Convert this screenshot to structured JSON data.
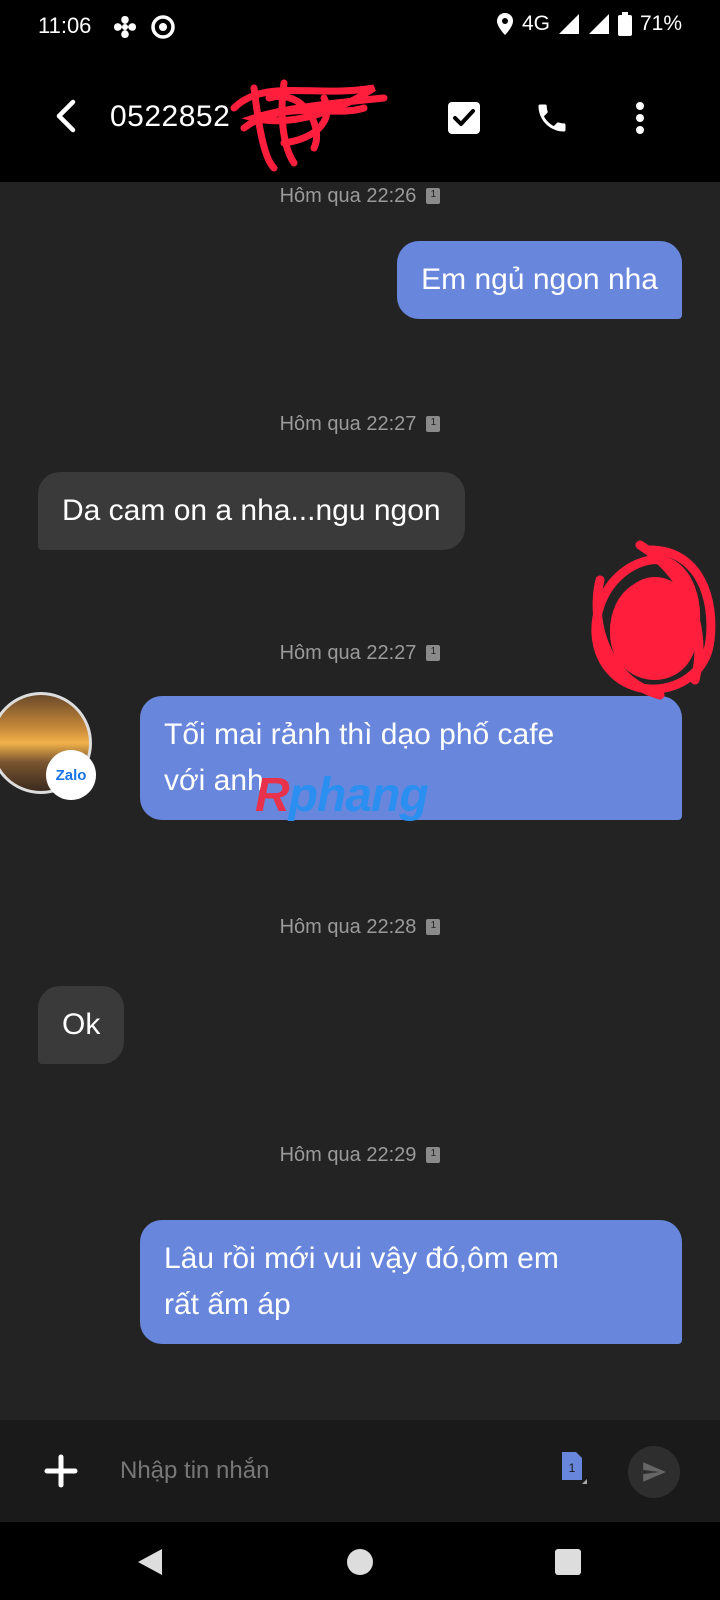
{
  "status_bar": {
    "time": "11:06",
    "network": "4G",
    "battery": "71%"
  },
  "header": {
    "contact": "0522852",
    "accent_color": "#6886dc"
  },
  "messages": [
    {
      "timestamp": "Hôm qua 22:26",
      "direction": "out",
      "text": "Em ngủ ngon nha"
    },
    {
      "timestamp": "Hôm qua 22:27",
      "direction": "in",
      "text": "Da cam on a nha...ngu ngon"
    },
    {
      "timestamp": "Hôm qua 22:27",
      "direction": "out",
      "line1": "Tối mai rảnh thì dạo phố cafe",
      "line2": "với anh"
    },
    {
      "timestamp": "Hôm qua 22:28",
      "direction": "in",
      "text": "Ok"
    },
    {
      "timestamp": "Hôm qua 22:29",
      "direction": "out",
      "line1": "Lâu rồi mới vui vậy đó,ôm em",
      "line2": "rất ấm áp"
    }
  ],
  "avatar": {
    "badge": "Zalo"
  },
  "watermark": {
    "first": "R",
    "rest": "phang"
  },
  "composer": {
    "placeholder": "Nhập tin nhắn"
  }
}
